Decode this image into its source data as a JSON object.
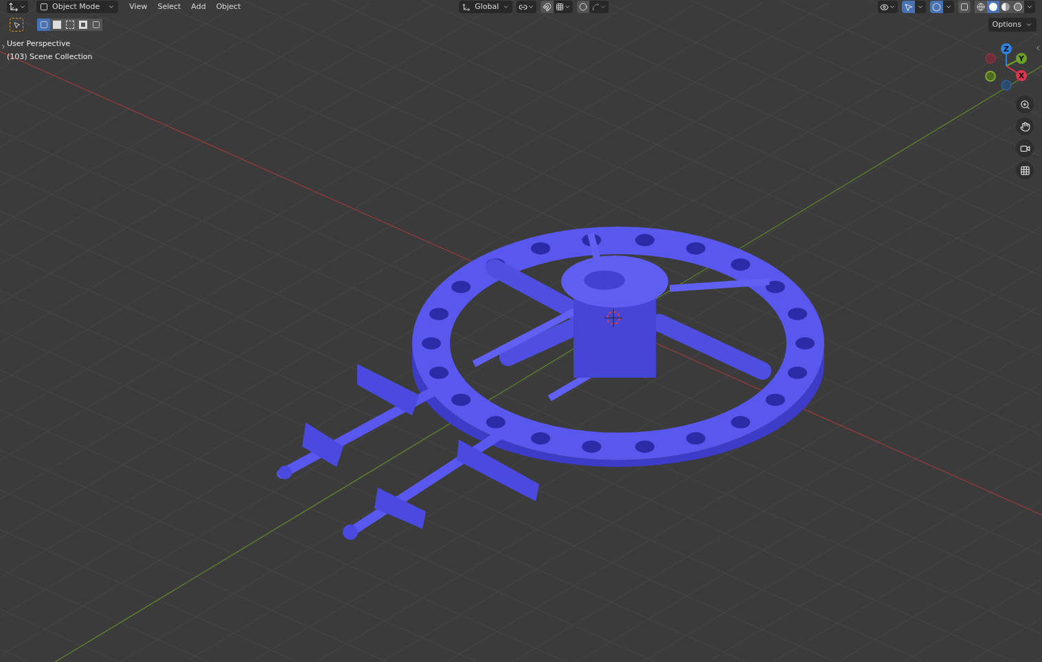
{
  "header": {
    "mode": "Object Mode",
    "menus": [
      {
        "label": "View"
      },
      {
        "label": "Select"
      },
      {
        "label": "Add"
      },
      {
        "label": "Object"
      }
    ],
    "transform_orientation": "Global",
    "snap_on": false,
    "proportional_on": false,
    "gizmos_on": true,
    "overlays_on": true,
    "xray_on": false,
    "shading_modes": [
      {
        "kind": "wireframe",
        "selected": false
      },
      {
        "kind": "solid",
        "selected": true
      },
      {
        "kind": "material",
        "selected": false
      },
      {
        "kind": "rendered",
        "selected": false
      }
    ],
    "options": "Options"
  },
  "toolbar": {
    "select_modes": [
      {
        "kind": "new",
        "selected": true
      },
      {
        "kind": "extend",
        "selected": false
      },
      {
        "kind": "subtract",
        "selected": false
      },
      {
        "kind": "invert",
        "selected": false
      },
      {
        "kind": "intersect",
        "selected": false
      }
    ]
  },
  "overlay_text": [
    "User Perspective",
    "(103) Scene Collection"
  ],
  "gizmo": {
    "axes": [
      {
        "label": "Z"
      },
      {
        "label": "Y"
      },
      {
        "label": "X"
      }
    ]
  }
}
